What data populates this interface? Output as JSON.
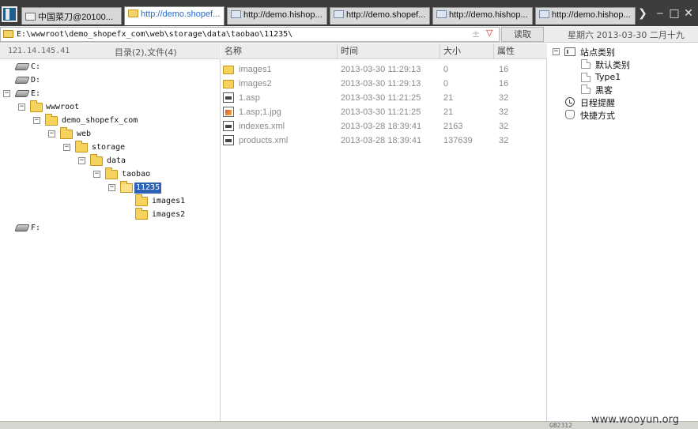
{
  "tabs": [
    {
      "label": "中国菜刀@20100...",
      "icon": "window-icon",
      "active": false
    },
    {
      "label": "http://demo.shopef...",
      "icon": "folder-icon",
      "active": true
    },
    {
      "label": "http://demo.hishop...",
      "icon": "page-icon",
      "active": false
    },
    {
      "label": "http://demo.shopef...",
      "icon": "page-icon",
      "active": false
    },
    {
      "label": "http://demo.hishop...",
      "icon": "page-icon",
      "active": false
    },
    {
      "label": "http://demo.hishop...",
      "icon": "page-icon",
      "active": false
    }
  ],
  "address": {
    "path": "E:\\wwwroot\\demo_shopefx_com\\web\\storage\\data\\taobao\\11235\\",
    "plus_glyph": "±",
    "dropdown_glyph": "▽",
    "read_label": "读取",
    "date_label": "星期六 2013-03-30 二月十九"
  },
  "left": {
    "ip": "121.14.145.41",
    "summary": "目录(2),文件(4)",
    "tree": [
      {
        "label": "C:",
        "type": "drive",
        "toggle": ""
      },
      {
        "label": "D:",
        "type": "drive",
        "toggle": ""
      },
      {
        "label": "E:",
        "type": "drive",
        "toggle": "−"
      },
      {
        "label": "wwwroot",
        "type": "folder",
        "toggle": "−"
      },
      {
        "label": "demo_shopefx_com",
        "type": "folder",
        "toggle": "−"
      },
      {
        "label": "web",
        "type": "folder",
        "toggle": "−"
      },
      {
        "label": "storage",
        "type": "folder",
        "toggle": "−"
      },
      {
        "label": "data",
        "type": "folder",
        "toggle": "−"
      },
      {
        "label": "taobao",
        "type": "folder",
        "toggle": "−"
      },
      {
        "label": "11235",
        "type": "folder-open",
        "toggle": "−",
        "selected": true
      },
      {
        "label": "images1",
        "type": "folder",
        "toggle": ""
      },
      {
        "label": "images2",
        "type": "folder",
        "toggle": ""
      },
      {
        "label": "F:",
        "type": "drive",
        "toggle": ""
      }
    ]
  },
  "files": {
    "columns": {
      "name": "名称",
      "time": "时间",
      "size": "大小",
      "attr": "属性"
    },
    "rows": [
      {
        "name": "images1",
        "time": "2013-03-30 11:29:13",
        "size": "0",
        "attr": "16",
        "icon": "folder-icon"
      },
      {
        "name": "images2",
        "time": "2013-03-30 11:29:13",
        "size": "0",
        "attr": "16",
        "icon": "folder-icon"
      },
      {
        "name": "1.asp",
        "time": "2013-03-30 11:21:25",
        "size": "21",
        "attr": "32",
        "icon": "asp-file-icon"
      },
      {
        "name": "1.asp;1.jpg",
        "time": "2013-03-30 11:21:25",
        "size": "21",
        "attr": "32",
        "icon": "image-file-icon"
      },
      {
        "name": "indexes.xml",
        "time": "2013-03-28 18:39:41",
        "size": "2163",
        "attr": "32",
        "icon": "xml-file-icon"
      },
      {
        "name": "products.xml",
        "time": "2013-03-28 18:39:41",
        "size": "137639",
        "attr": "32",
        "icon": "xml-file-icon"
      }
    ]
  },
  "right": {
    "root": {
      "label": "站点类别",
      "toggle": "−"
    },
    "items": [
      {
        "label": "默认类别"
      },
      {
        "label": "Type1"
      },
      {
        "label": "黑客"
      }
    ],
    "schedule": "日程提醒",
    "shortcut": "快捷方式"
  },
  "status": {
    "text": "GB2312"
  },
  "watermark": "www.wooyun.org",
  "colors": {
    "tabbar": "#3d3d3d",
    "selection": "#2d62b8",
    "active_tab_text": "#2a6bc6"
  }
}
